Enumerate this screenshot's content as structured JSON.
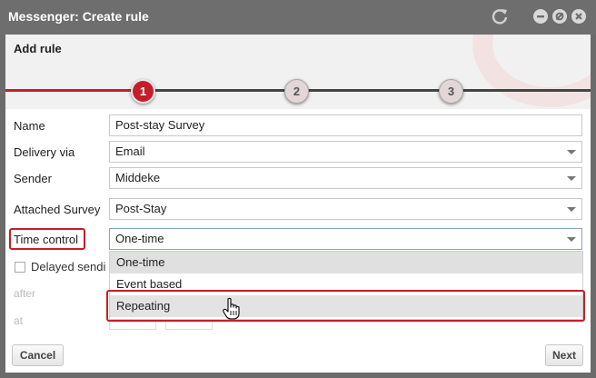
{
  "window": {
    "title": "Messenger: Create rule"
  },
  "header": {
    "title": "Add rule"
  },
  "steps": [
    {
      "label": "1",
      "state": "active"
    },
    {
      "label": "2",
      "state": "idle"
    },
    {
      "label": "3",
      "state": "idle"
    }
  ],
  "form": {
    "name": {
      "label": "Name",
      "value": "Post-stay Survey"
    },
    "delivery": {
      "label": "Delivery via",
      "value": "Email"
    },
    "sender": {
      "label": "Sender",
      "value": "Middeke"
    },
    "survey": {
      "label": "Attached Survey",
      "value": "Post-Stay"
    },
    "time_control": {
      "label": "Time control",
      "value": "One-time"
    },
    "delayed": {
      "label": "Delayed sendi"
    },
    "after": {
      "label": "after"
    },
    "at": {
      "label": "at"
    }
  },
  "dropdown": {
    "options": [
      "One-time",
      "Event based",
      "Repeating"
    ]
  },
  "buttons": {
    "cancel": "Cancel",
    "next": "Next"
  },
  "colors": {
    "accent": "#c41e2a",
    "titlebar": "#6e6e6e"
  }
}
